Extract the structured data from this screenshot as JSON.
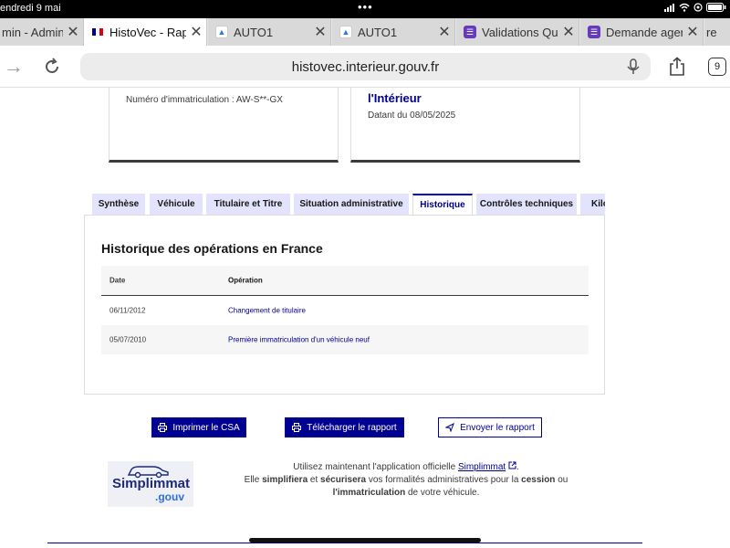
{
  "status_bar": {
    "time": "endredi 9 mai",
    "battery": ""
  },
  "browser": {
    "tabs": [
      {
        "title": "min - Admin",
        "favicon": "generic"
      },
      {
        "title": "HistoVec - Rapp",
        "favicon": "french-flag",
        "active": true
      },
      {
        "title": "AUTO1",
        "favicon": "auto1"
      },
      {
        "title": "AUTO1",
        "favicon": "auto1"
      },
      {
        "title": "Validations Qua",
        "favicon": "purple-doc"
      },
      {
        "title": "Demande agen",
        "favicon": "purple-doc"
      },
      {
        "title": "re",
        "favicon": ""
      }
    ],
    "url": "histovec.interieur.gouv.fr",
    "tab_count": "9"
  },
  "cards": {
    "left": {
      "immat_label": "Numéro d'immatriculation : AW-S**-GX"
    },
    "right": {
      "title": "l'Intérieur",
      "date": "Datant du 08/05/2025"
    }
  },
  "report_tabs": [
    "Synthèse",
    "Véhicule",
    "Titulaire et Titre",
    "Situation administrative",
    "Historique",
    "Contrôles techniques",
    "Kilo"
  ],
  "active_tab": "Historique",
  "history": {
    "title": "Historique des opérations en France",
    "headers": {
      "date": "Date",
      "operation": "Opération"
    },
    "rows": [
      {
        "date": "06/11/2012",
        "operation": "Changement de titulaire"
      },
      {
        "date": "05/07/2010",
        "operation": "Première immatriculation d'un véhicule neuf"
      }
    ]
  },
  "actions": {
    "print": "Imprimer le CSA",
    "download": "Télécharger le rapport",
    "send": "Envoyer le rapport"
  },
  "promo": {
    "logo_text_1": "Simplimmat",
    "logo_text_2": ".gouv",
    "line1_prefix": "Utilisez maintenant l'application officielle ",
    "link": "Simplimmat",
    "line1_suffix": ".",
    "line2_a": "Elle ",
    "line2_b": "simplifiera",
    "line2_c": " et ",
    "line2_d": "sécurisera",
    "line2_e": " vos formalités administratives pour la ",
    "line2_f": "cession",
    "line2_g": " ou",
    "line3_a": "l'immatriculation",
    "line3_b": " de votre véhicule."
  },
  "colors": {
    "accent": "#000091",
    "tab_bg": "#e3e3fd"
  }
}
